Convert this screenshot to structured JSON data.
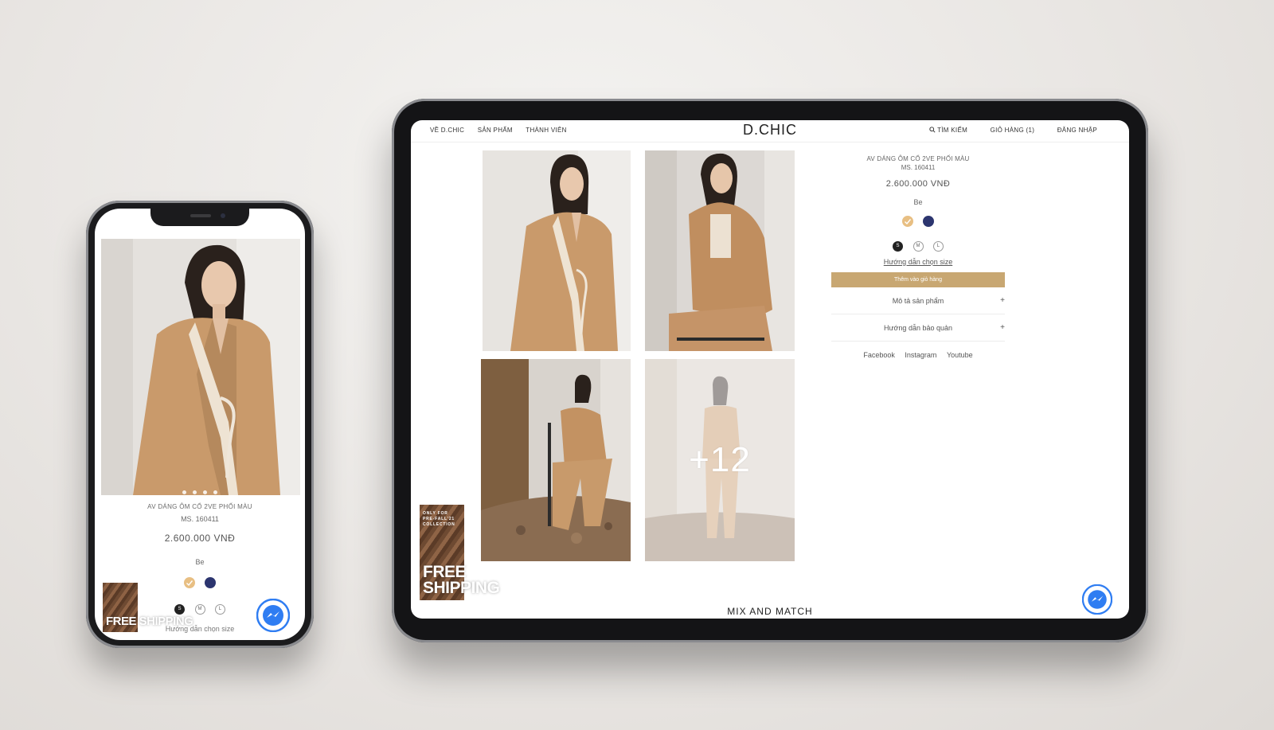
{
  "colors": {
    "accent": "#c8a772",
    "swatch_beige": "#e8bf83",
    "swatch_navy": "#2c356f",
    "messenger": "#2f7df2"
  },
  "tablet": {
    "nav": {
      "left": [
        "VỀ D.CHIC",
        "SẢN PHẨM",
        "THÀNH VIÊN"
      ],
      "logo": "D.CHIC",
      "right": {
        "search": "TÌM KIẾM",
        "cart": "GIỎ HÀNG (1)",
        "login": "ĐĂNG NHẬP"
      },
      "search_icon": "search-icon"
    },
    "gallery": {
      "more_count": "+12"
    },
    "product": {
      "name": "AV DÁNG ÔM CỔ 2VE PHỐI MÀU",
      "code": "MS. 160411",
      "price": "2.600.000 VNĐ",
      "color_label": "Be",
      "sizes": [
        "S",
        "M",
        "L"
      ],
      "selected_size": "S",
      "size_guide": "Hướng dẫn chọn size",
      "add_to_cart": "Thêm vào giỏ hàng",
      "accordion": [
        {
          "label": "Mô tả sản phẩm",
          "icon": "+"
        },
        {
          "label": "Hướng dẫn bảo quản",
          "icon": "+"
        }
      ],
      "social": [
        "Facebook",
        "Instagram",
        "Youtube"
      ]
    },
    "section_title": "MIX AND MATCH",
    "banner": {
      "small_lines": [
        "ONLY FOR",
        "PRE-FALL'21",
        "COLLECTION"
      ],
      "big_lines": [
        "FREE",
        "SHIPPING"
      ]
    }
  },
  "phone": {
    "product": {
      "name": "AV DÁNG ÔM CỔ 2VE PHỐI MÀU",
      "code": "MS. 160411",
      "price": "2.600.000 VNĐ",
      "color_label": "Be",
      "sizes": [
        "S",
        "M",
        "L"
      ],
      "selected_size": "S",
      "size_guide": "Hướng dẫn chọn size"
    },
    "banner_text": "FREE SHIPPING"
  }
}
